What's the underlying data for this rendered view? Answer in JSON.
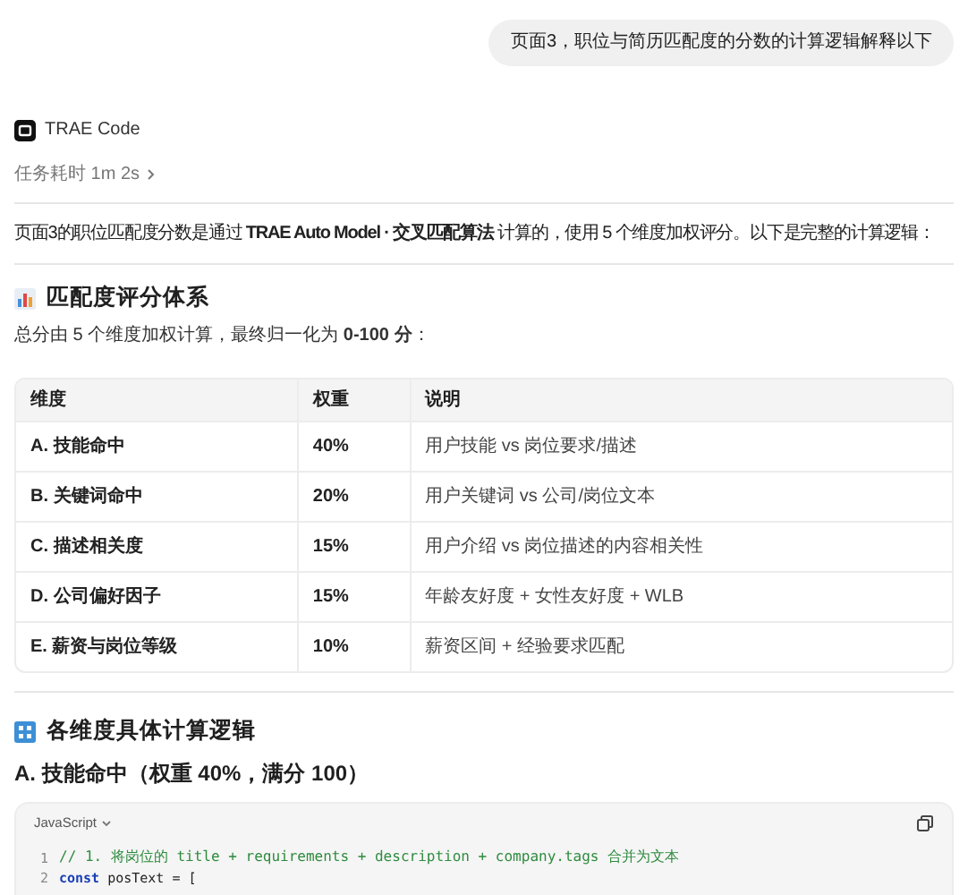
{
  "user_message": "页面3，职位与简历匹配度的分数的计算逻辑解释以下",
  "assistant": {
    "name": "TRAE Code",
    "task_time": "任务耗时 1m 2s"
  },
  "intro": "页面3的职位匹配度分数是通过 **TRAE Auto Model · 交叉匹配算法** 计算的，使用 5 个维度加权评分。以下是完整的计算逻辑：",
  "section_1": {
    "title": "匹配度评分体系",
    "subtitle": "总分由 5 个维度加权计算，最终归一化为 **0-100 分**："
  },
  "table": {
    "columns": [
      "维度",
      "权重",
      "说明"
    ],
    "rows": [
      {
        "cells": [
          "A. 技能命中",
          "40%",
          "用户技能 vs 岗位要求/描述"
        ]
      },
      {
        "cells": [
          "B. 关键词命中",
          "20%",
          "用户关键词 vs 公司/岗位文本"
        ]
      },
      {
        "cells": [
          "C. 描述相关度",
          "15%",
          "用户介绍 vs 岗位描述的内容相关性"
        ]
      },
      {
        "cells": [
          "D. 公司偏好因子",
          "15%",
          "年龄友好度 + 女性友好度 + WLB"
        ]
      },
      {
        "cells": [
          "E. 薪资与岗位等级",
          "10%",
          "薪资区间 + 经验要求匹配"
        ]
      }
    ]
  },
  "section_2": {
    "title": "各维度具体计算逻辑",
    "subtitle": "A. 技能命中（权重 40%，满分 100）"
  },
  "code_block": {
    "language": "JavaScript",
    "lines": [
      {
        "number": "1",
        "tokens": [
          {
            "kind": "comment",
            "text": "// 1. 将岗位的 title + requirements + description + company.tags 合并为文本"
          }
        ]
      },
      {
        "number": "2",
        "tokens": [
          {
            "kind": "keyword",
            "text": "const"
          },
          {
            "kind": "plain",
            "text": "posText = ["
          }
        ]
      }
    ]
  }
}
